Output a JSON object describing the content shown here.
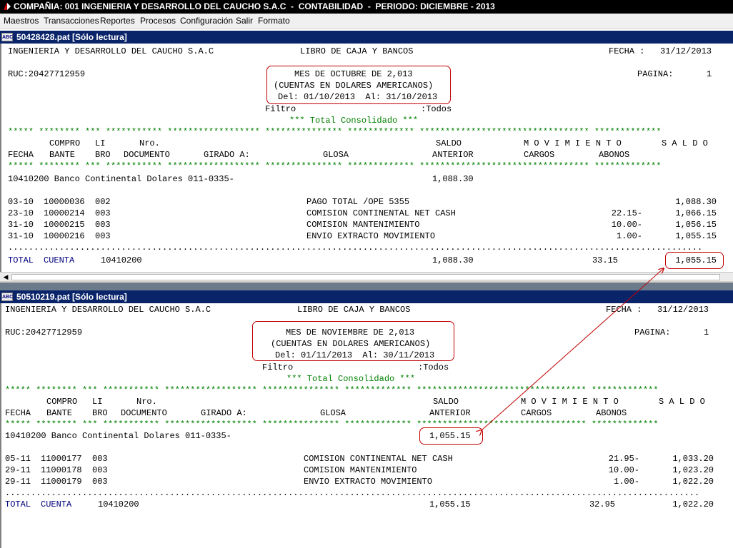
{
  "window": {
    "title": "COMPAÑIA: 001 INGENIERIA Y DESARROLLO DEL CAUCHO S.A.C  -  CONTABILIDAD  -  PERIODO: DICIEMBRE - 2013",
    "app_icon": "app-icon"
  },
  "menu": {
    "items": [
      "Maestros",
      "Transacciones",
      "Reportes",
      "Procesos",
      "Configuración",
      "Salir",
      "Formato"
    ]
  },
  "colors": {
    "doc_titlebar": "#0a246a",
    "stars": "#008000",
    "highlight": "#c00000",
    "total_label": "#000080"
  },
  "reports": [
    {
      "doc_title": "50428428.pat [Sólo lectura]",
      "doc_icon_label": "ABC",
      "company": "INGENIERIA Y DESARROLLO DEL CAUCHO S.A.C",
      "book": "LIBRO DE CAJA Y BANCOS",
      "fecha_label": "FECHA :",
      "fecha": "31/12/2013",
      "ruc": "RUC:20427712959",
      "mes": "MES DE OCTUBRE DE 2,013",
      "moneda": "(CUENTAS EN DOLARES AMERICANOS)",
      "rango": "Del: 01/10/2013  Al: 31/10/2013",
      "pagina_label": "PAGINA:",
      "pagina": "1",
      "filtro_label": "Filtro",
      "filtro": ":Todos",
      "consolidado": "*** Total Consolidado ***",
      "headers": {
        "h1": {
          "compro": "COMPRO",
          "li": "LI",
          "nro": "Nro.",
          "saldo": "SALDO",
          "movimiento": "M O V I M I E N T O",
          "saldo_col": "S A L D O"
        },
        "h2": {
          "fecha": "FECHA",
          "bante": "BANTE",
          "bro": "BRO",
          "documento": "DOCUMENTO",
          "girado": "GIRADO A:",
          "glosa": "GLOSA",
          "anterior": "ANTERIOR",
          "cargos": "CARGOS",
          "abonos": "ABONOS"
        }
      },
      "account": {
        "line": "10410200 Banco Continental Dolares 011-0335-",
        "saldo_anterior": "1,088.30"
      },
      "rows": [
        {
          "fecha": "03-10",
          "comprobante": "10000036",
          "libro": "002",
          "glosa": "PAGO TOTAL /OPE 5355",
          "abonos": "",
          "saldo": "1,088.30"
        },
        {
          "fecha": "23-10",
          "comprobante": "10000214",
          "libro": "003",
          "glosa": "COMISION CONTINENTAL NET CASH",
          "abonos": "22.15-",
          "saldo": "1,066.15"
        },
        {
          "fecha": "31-10",
          "comprobante": "10000215",
          "libro": "003",
          "glosa": "COMISION MANTENIMIENTO",
          "abonos": "10.00-",
          "saldo": "1,056.15"
        },
        {
          "fecha": "31-10",
          "comprobante": "10000216",
          "libro": "003",
          "glosa": "ENVIO EXTRACTO MOVIMIENTO",
          "abonos": "1.00-",
          "saldo": "1,055.15"
        }
      ],
      "total": {
        "label": "TOTAL",
        "cuenta": "CUENTA",
        "code": "10410200",
        "anterior": "1,088.30",
        "abonos": "33.15",
        "saldo": "1,055.15"
      }
    },
    {
      "doc_title": "50510219.pat [Sólo lectura]",
      "doc_icon_label": "ABC",
      "company": "INGENIERIA Y DESARROLLO DEL CAUCHO S.A.C",
      "book": "LIBRO DE CAJA Y BANCOS",
      "fecha_label": "FECHA :",
      "fecha": "31/12/2013",
      "ruc": "RUC:20427712959",
      "mes": "MES DE NOVIEMBRE DE 2,013",
      "moneda": "(CUENTAS EN DOLARES AMERICANOS)",
      "rango": "Del: 01/11/2013  Al: 30/11/2013",
      "pagina_label": "PAGINA:",
      "pagina": "1",
      "filtro_label": "Filtro",
      "filtro": ":Todos",
      "consolidado": "*** Total Consolidado ***",
      "headers": {
        "h1": {
          "compro": "COMPRO",
          "li": "LI",
          "nro": "Nro.",
          "saldo": "SALDO",
          "movimiento": "M O V I M I E N T O",
          "saldo_col": "S A L D O"
        },
        "h2": {
          "fecha": "FECHA",
          "bante": "BANTE",
          "bro": "BRO",
          "documento": "DOCUMENTO",
          "girado": "GIRADO A:",
          "glosa": "GLOSA",
          "anterior": "ANTERIOR",
          "cargos": "CARGOS",
          "abonos": "ABONOS"
        }
      },
      "account": {
        "line": "10410200 Banco Continental Dolares 011-0335-",
        "saldo_anterior": "1,055.15"
      },
      "rows": [
        {
          "fecha": "05-11",
          "comprobante": "11000177",
          "libro": "003",
          "glosa": "COMISION CONTINENTAL NET CASH",
          "abonos": "21.95-",
          "saldo": "1,033.20"
        },
        {
          "fecha": "29-11",
          "comprobante": "11000178",
          "libro": "003",
          "glosa": "COMISION MANTENIMIENTO",
          "abonos": "10.00-",
          "saldo": "1,023.20"
        },
        {
          "fecha": "29-11",
          "comprobante": "11000179",
          "libro": "003",
          "glosa": "ENVIO EXTRACTO MOVIMIENTO",
          "abonos": "1.00-",
          "saldo": "1,022.20"
        }
      ],
      "total": {
        "label": "TOTAL",
        "cuenta": "CUENTA",
        "code": "10410200",
        "anterior": "1,055.15",
        "abonos": "32.95",
        "saldo": "1,022.20"
      }
    }
  ]
}
